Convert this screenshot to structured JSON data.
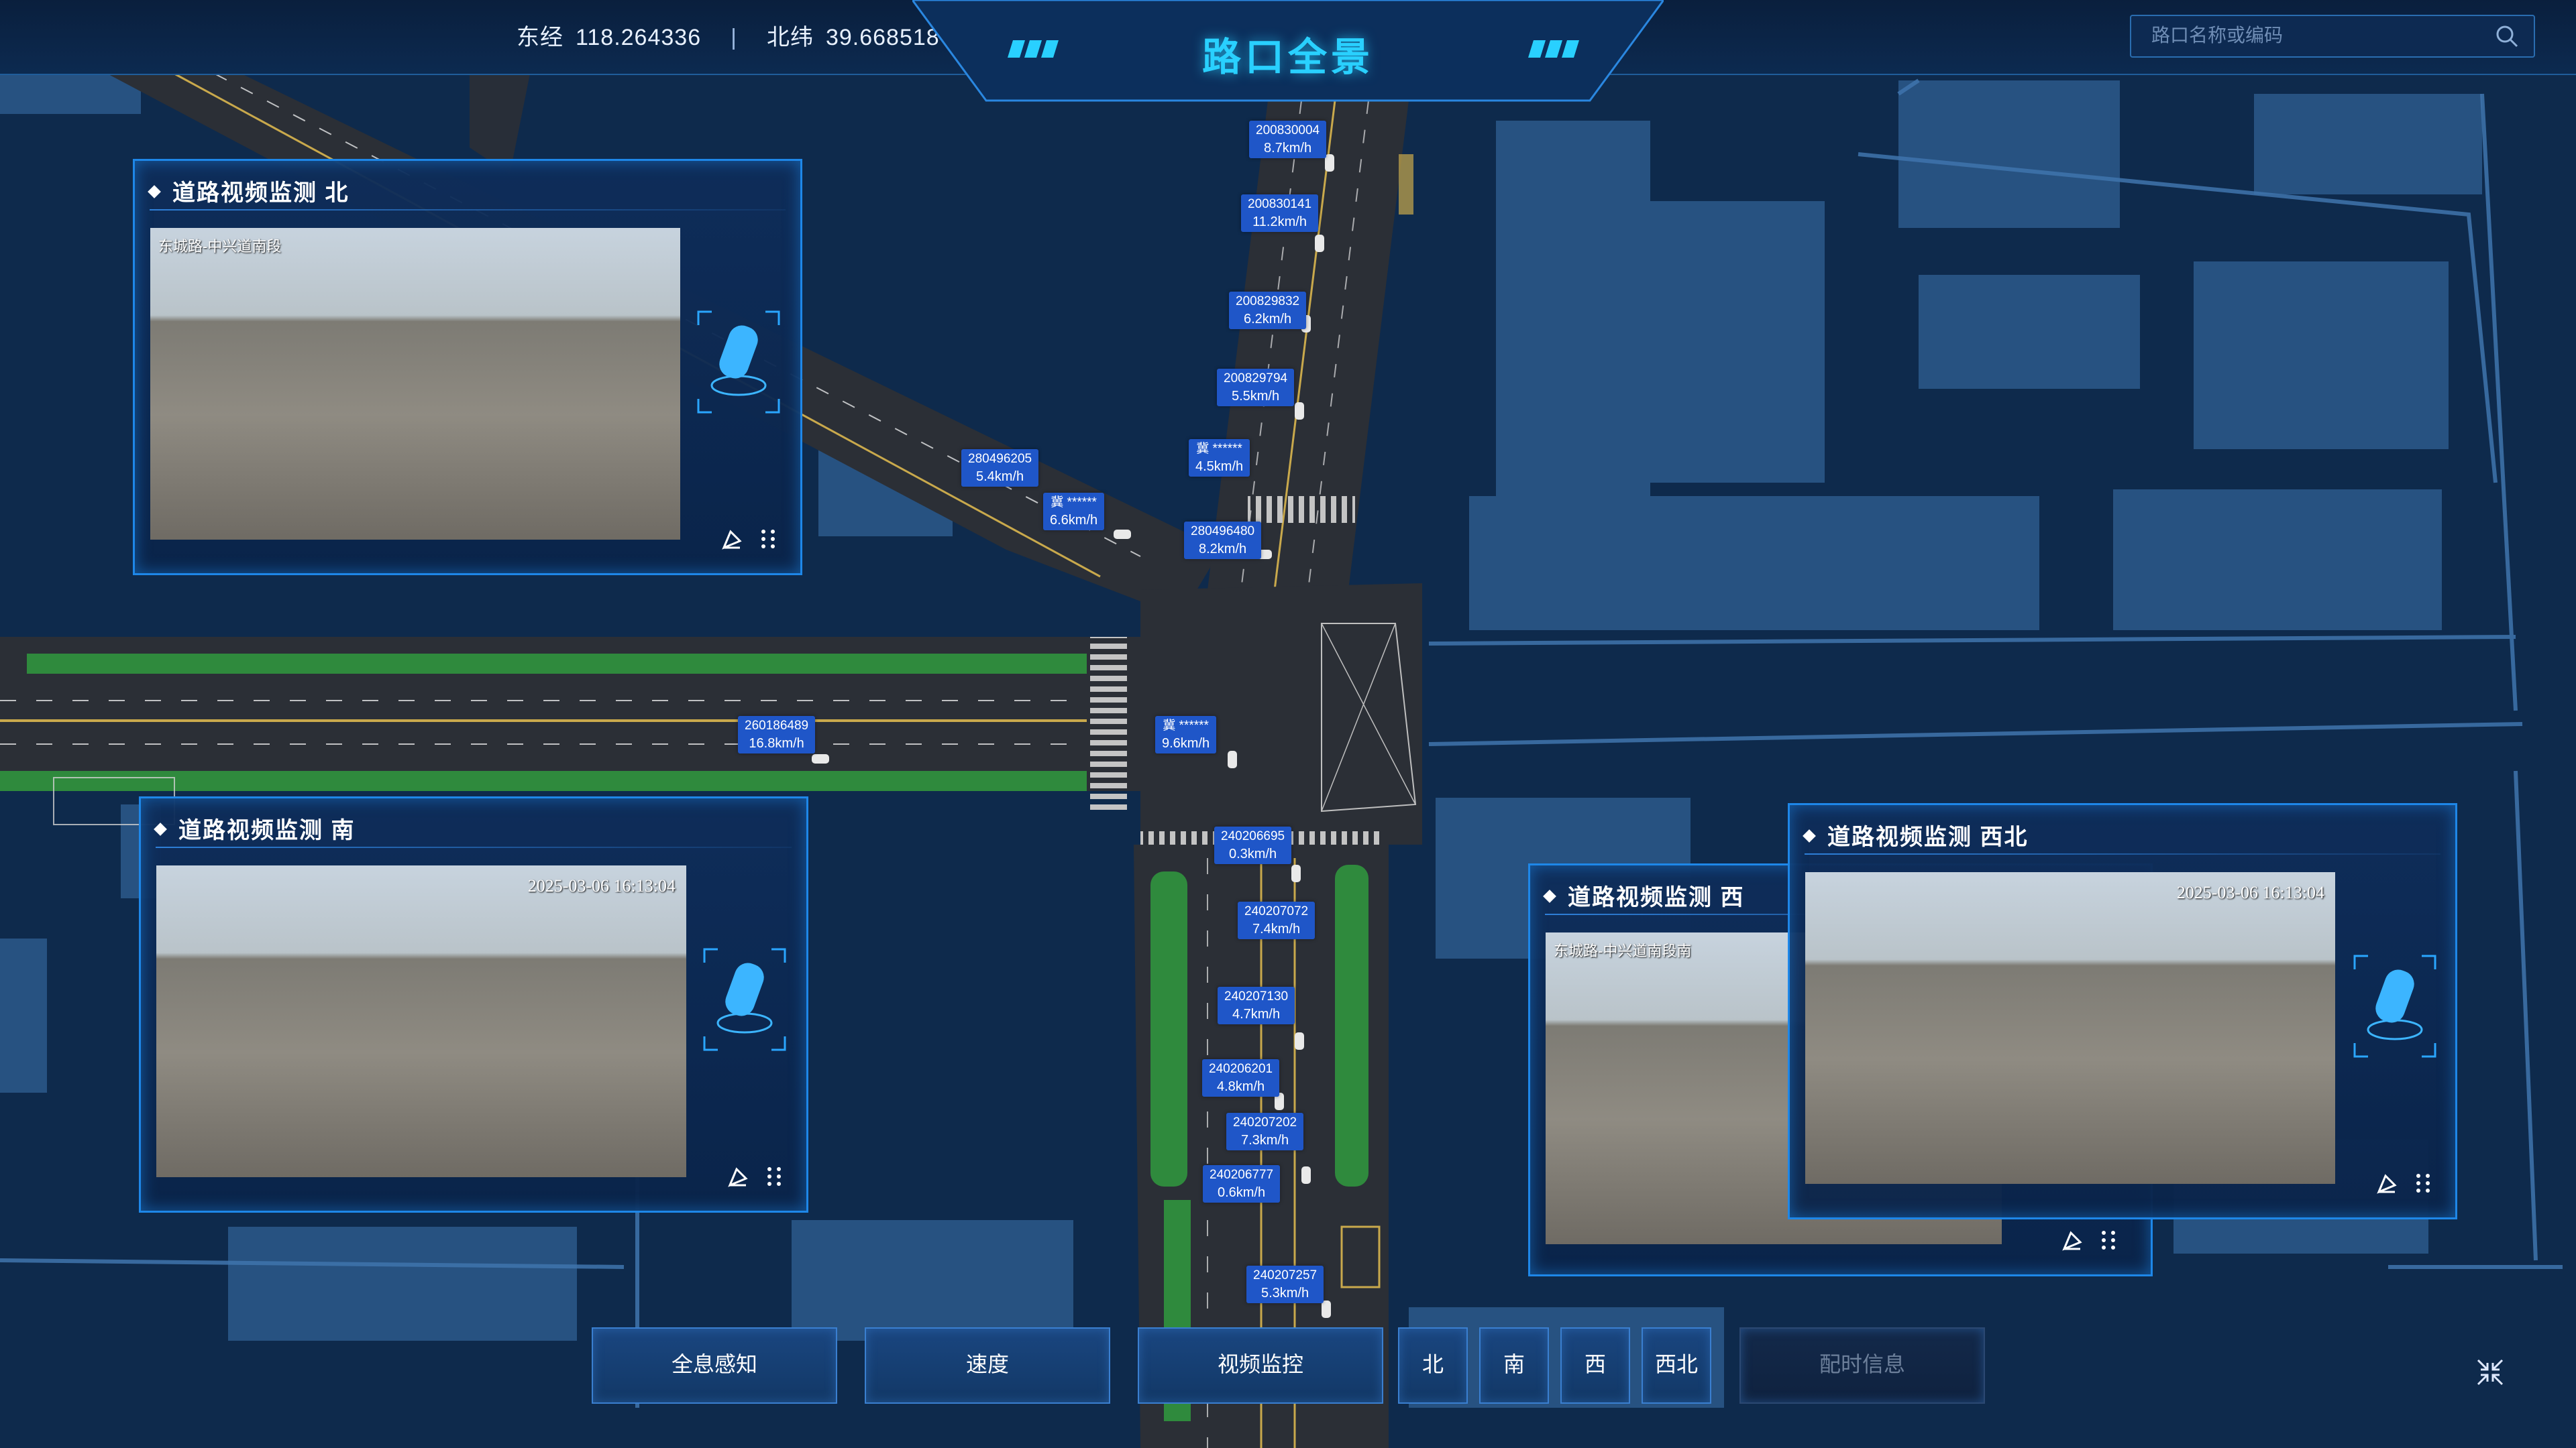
{
  "header": {
    "longitude_label": "东经",
    "longitude_value": "118.264336",
    "separator": "|",
    "latitude_label": "北纬",
    "latitude_value": "39.668518",
    "title": "路口全景",
    "search_placeholder": "路口名称或编码"
  },
  "vehicle_labels": [
    {
      "id": "200830004",
      "speed": "8.7km/h"
    },
    {
      "id": "200830141",
      "speed": "11.2km/h"
    },
    {
      "id": "200829832",
      "speed": "6.2km/h"
    },
    {
      "id": "200829794",
      "speed": "5.5km/h"
    },
    {
      "id": "冀 ******",
      "speed": "4.5km/h"
    },
    {
      "id": "280496205",
      "speed": "5.4km/h"
    },
    {
      "id": "冀 ******",
      "speed": "6.6km/h"
    },
    {
      "id": "280496480",
      "speed": "8.2km/h"
    },
    {
      "id": "260186489",
      "speed": "16.8km/h"
    },
    {
      "id": "冀 ******",
      "speed": "9.6km/h"
    },
    {
      "id": "240206695",
      "speed": "0.3km/h"
    },
    {
      "id": "240207072",
      "speed": "7.4km/h"
    },
    {
      "id": "240207130",
      "speed": "4.7km/h"
    },
    {
      "id": "240206201",
      "speed": "4.8km/h"
    },
    {
      "id": "240207202",
      "speed": "7.3km/h"
    },
    {
      "id": "240206777",
      "speed": "0.6km/h"
    },
    {
      "id": "240207257",
      "speed": "5.3km/h"
    }
  ],
  "panels": {
    "north": {
      "title": "道路视频监测  北",
      "osd": "东城路-中兴道南段"
    },
    "south": {
      "title": "道路视频监测  南",
      "osd_time": "2025-03-06  16:13:04"
    },
    "west": {
      "title": "道路视频监测  西",
      "osd": "东城路-中兴道南段南"
    },
    "northwest": {
      "title": "道路视频监测  西北",
      "osd_time": "2025-03-06  16:13:04"
    }
  },
  "bottom_buttons": {
    "holo": "全息感知",
    "speed": "速度",
    "video": "视频监控",
    "north": "北",
    "south": "南",
    "west": "西",
    "northwest": "西北",
    "timing": "配时信息"
  },
  "icons": {
    "search": "search-icon",
    "camera": "camera-icon",
    "snapshot": "pen-icon",
    "grid": "grid-dots-icon",
    "collapse": "collapse-arrows-icon"
  },
  "colors": {
    "accent": "#29d0ff",
    "panel_border": "#1e87e8",
    "label_bg": "#1f56c8",
    "map_bg": "#0b2342"
  }
}
